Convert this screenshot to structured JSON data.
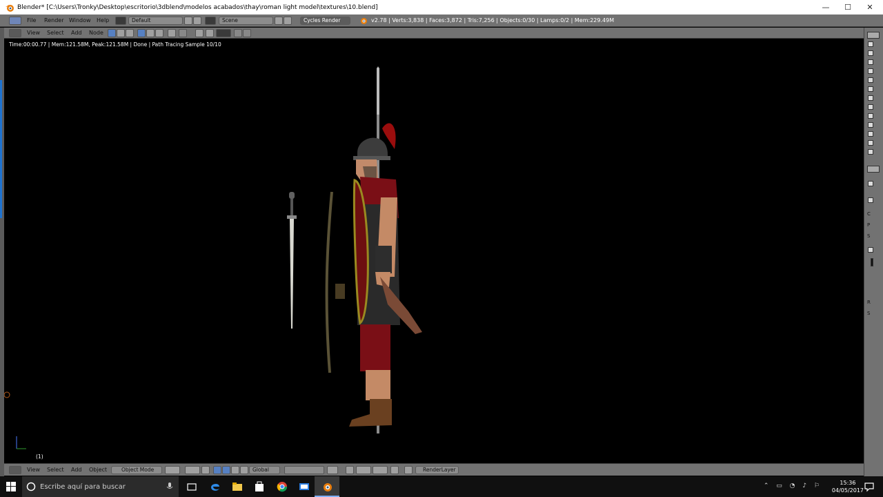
{
  "window": {
    "title": "Blender* [C:\\Users\\Tronky\\Desktop\\escritorio\\3dblend\\modelos acabados\\thay\\roman light model\\textures\\10.blend]",
    "minimize": "—",
    "maximize": "☐",
    "close": "✕"
  },
  "info_header": {
    "menus": [
      "File",
      "Render",
      "Window",
      "Help"
    ],
    "layout": "Default",
    "scene": "Scene",
    "engine": "Cycles Render",
    "stats": "v2.78 | Verts:3,838 | Faces:3,872 | Tris:7,256 | Objects:0/30 | Lamps:0/2 | Mem:229.49M"
  },
  "node_header": {
    "menus": [
      "View",
      "Select",
      "Add",
      "Node"
    ]
  },
  "render": {
    "stats": "Time:00:00.77 | Mem:121.58M, Peak:121.58M | Done | Path Tracing Sample 10/10",
    "frame": "(1)"
  },
  "view_header": {
    "menus": [
      "View",
      "Select",
      "Add",
      "Object"
    ],
    "mode": "Object Mode",
    "orientation": "Global",
    "render_layer": "RenderLayer"
  },
  "right_panel": {
    "labels": [
      "C",
      "P",
      "S",
      "R",
      "S"
    ]
  },
  "taskbar": {
    "search_placeholder": "Escribe aquí para buscar",
    "time": "15:36",
    "date": "04/05/2017"
  },
  "colors": {
    "header_gray": "#727272",
    "field_gray": "#8c8c8c",
    "accent_blue": "#5680c2",
    "blender_orange": "#e87d0d",
    "taskbar": "#101010"
  }
}
